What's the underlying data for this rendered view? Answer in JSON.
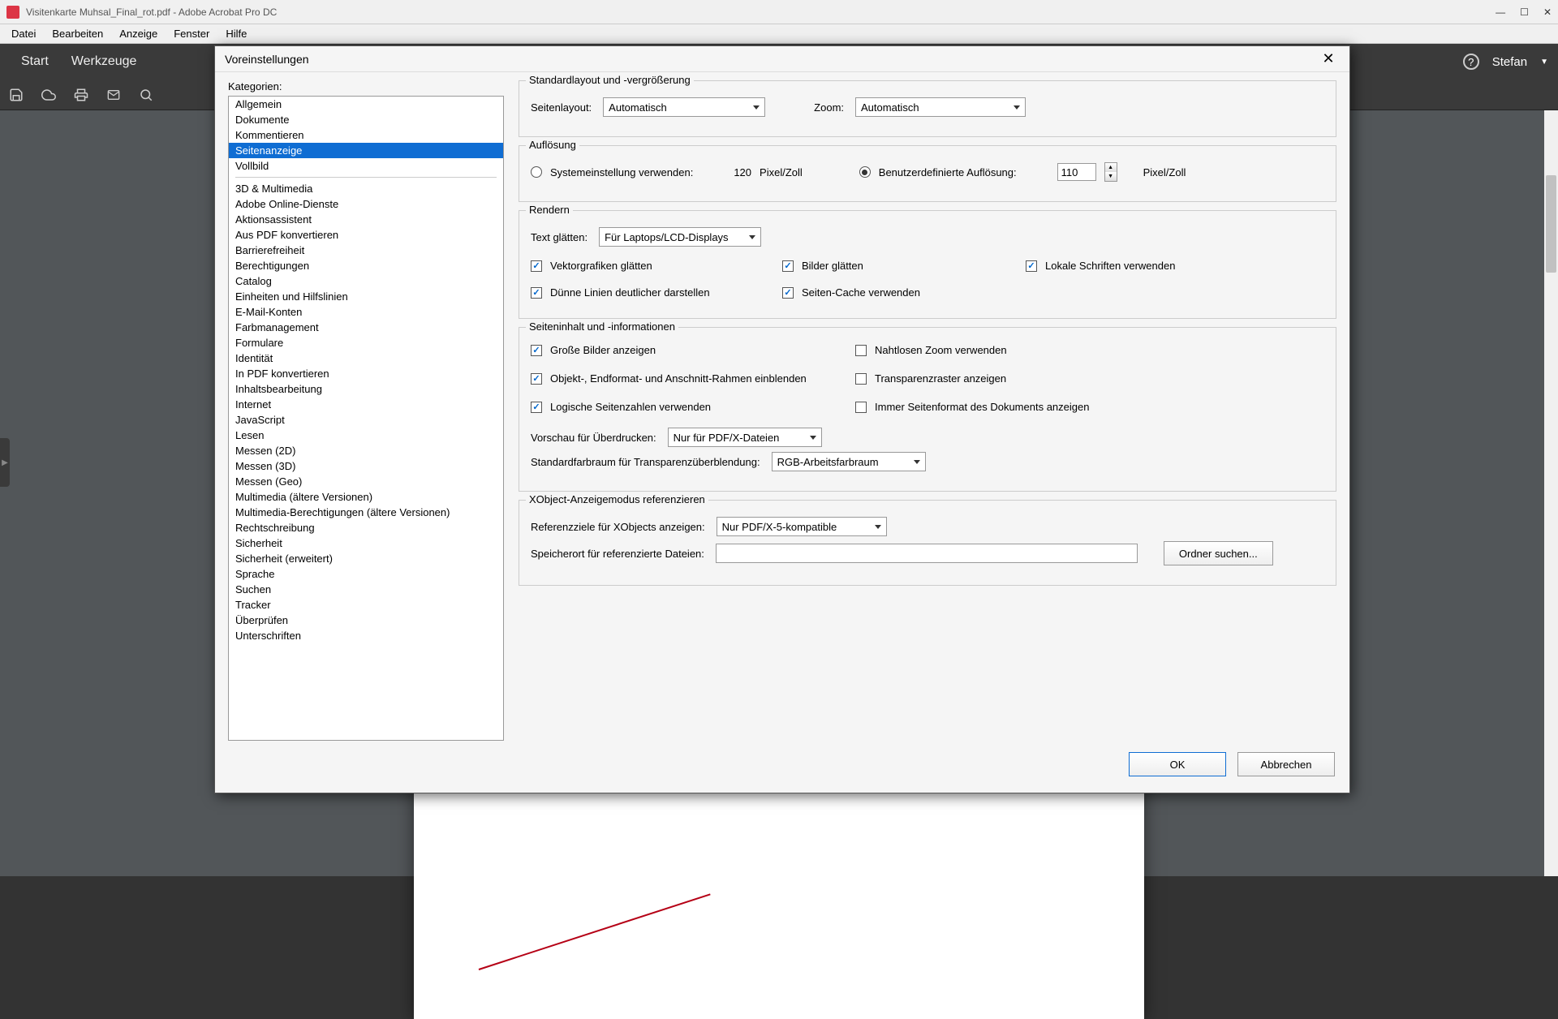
{
  "title": "Visitenkarte Muhsal_Final_rot.pdf - Adobe Acrobat Pro DC",
  "menu": [
    "Datei",
    "Bearbeiten",
    "Anzeige",
    "Fenster",
    "Hilfe"
  ],
  "tabs": {
    "start": "Start",
    "tools": "Werkzeuge"
  },
  "user": "Stefan",
  "dialog": {
    "title": "Voreinstellungen",
    "categories_label": "Kategorien:",
    "categories_top": [
      "Allgemein",
      "Dokumente",
      "Kommentieren",
      "Seitenanzeige",
      "Vollbild"
    ],
    "selected_index": 3,
    "categories_rest": [
      "3D & Multimedia",
      "Adobe Online-Dienste",
      "Aktionsassistent",
      "Aus PDF konvertieren",
      "Barrierefreiheit",
      "Berechtigungen",
      "Catalog",
      "Einheiten und Hilfslinien",
      "E-Mail-Konten",
      "Farbmanagement",
      "Formulare",
      "Identität",
      "In PDF konvertieren",
      "Inhaltsbearbeitung",
      "Internet",
      "JavaScript",
      "Lesen",
      "Messen (2D)",
      "Messen (3D)",
      "Messen (Geo)",
      "Multimedia (ältere Versionen)",
      "Multimedia-Berechtigungen (ältere Versionen)",
      "Rechtschreibung",
      "Sicherheit",
      "Sicherheit (erweitert)",
      "Sprache",
      "Suchen",
      "Tracker",
      "Überprüfen",
      "Unterschriften"
    ],
    "g1": {
      "title": "Standardlayout und -vergrößerung",
      "layout_label": "Seitenlayout:",
      "layout_value": "Automatisch",
      "zoom_label": "Zoom:",
      "zoom_value": "Automatisch"
    },
    "g2": {
      "title": "Auflösung",
      "sys_label": "Systemeinstellung verwenden:",
      "sys_value": "120",
      "unit": "Pixel/Zoll",
      "custom_label": "Benutzerdefinierte Auflösung:",
      "custom_value": "110"
    },
    "g3": {
      "title": "Rendern",
      "smooth_label": "Text glätten:",
      "smooth_value": "Für Laptops/LCD-Displays",
      "c1": "Vektorgrafiken glätten",
      "c2": "Bilder glätten",
      "c3": "Lokale Schriften verwenden",
      "c4": "Dünne Linien deutlicher darstellen",
      "c5": "Seiten-Cache verwenden"
    },
    "g4": {
      "title": "Seiteninhalt und -informationen",
      "c1": "Große Bilder anzeigen",
      "c2": "Nahtlosen Zoom verwenden",
      "c3": "Objekt-, Endformat- und Anschnitt-Rahmen einblenden",
      "c4": "Transparenzraster anzeigen",
      "c5": "Logische Seitenzahlen verwenden",
      "c6": "Immer Seitenformat des Dokuments anzeigen",
      "over_label": "Vorschau für Überdrucken:",
      "over_value": "Nur für PDF/X-Dateien",
      "blend_label": "Standardfarbraum für Transparenzüberblendung:",
      "blend_value": "RGB-Arbeitsfarbraum"
    },
    "g5": {
      "title": "XObject-Anzeigemodus referenzieren",
      "ref_label": "Referenzziele für XObjects anzeigen:",
      "ref_value": "Nur PDF/X-5-kompatible",
      "loc_label": "Speicherort für referenzierte Dateien:",
      "browse": "Ordner suchen..."
    },
    "ok": "OK",
    "cancel": "Abbrechen"
  }
}
